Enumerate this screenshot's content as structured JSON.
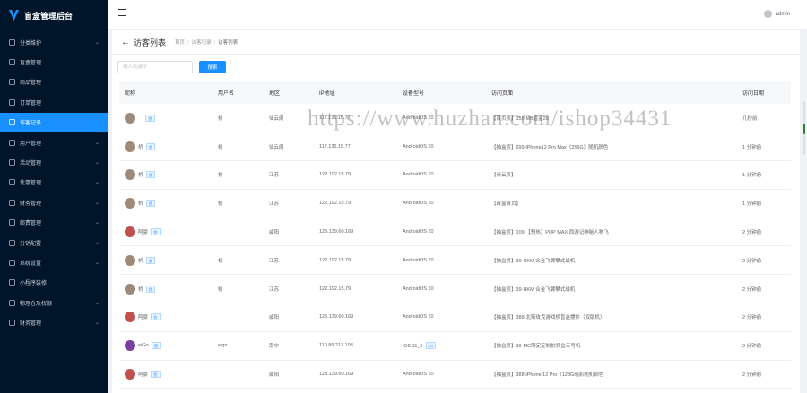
{
  "app": {
    "title": "盲盒管理后台"
  },
  "sidebar": {
    "items": [
      {
        "label": "分类维护",
        "icon": "grid-icon",
        "has_children": true,
        "active": false
      },
      {
        "label": "盲盒管理",
        "icon": "box-icon",
        "has_children": false,
        "active": false
      },
      {
        "label": "商品管理",
        "icon": "goods-icon",
        "has_children": false,
        "active": false
      },
      {
        "label": "订单管理",
        "icon": "order-icon",
        "has_children": false,
        "active": false
      },
      {
        "label": "访客记录",
        "icon": "visitor-icon",
        "has_children": false,
        "active": true
      },
      {
        "label": "用户管理",
        "icon": "user-icon",
        "has_children": true,
        "active": false
      },
      {
        "label": "活动管理",
        "icon": "activity-icon",
        "has_children": true,
        "active": false
      },
      {
        "label": "优惠管理",
        "icon": "coupon-icon",
        "has_children": true,
        "active": false
      },
      {
        "label": "财务管理",
        "icon": "finance-icon",
        "has_children": true,
        "active": false
      },
      {
        "label": "邮费管理",
        "icon": "shipping-icon",
        "has_children": true,
        "active": false
      },
      {
        "label": "分销配置",
        "icon": "share-icon",
        "has_children": true,
        "active": false
      },
      {
        "label": "系统设置",
        "icon": "settings-icon",
        "has_children": true,
        "active": false
      },
      {
        "label": "小程序装修",
        "icon": "miniapp-icon",
        "has_children": false,
        "active": false
      },
      {
        "label": "物理仓及权限",
        "icon": "warehouse-icon",
        "has_children": true,
        "active": false
      },
      {
        "label": "财务管理",
        "icon": "wallet-icon",
        "has_children": true,
        "active": false
      }
    ]
  },
  "header": {
    "username": "admin"
  },
  "page": {
    "title": "访客列表",
    "breadcrumb": [
      "首页",
      "访客记录",
      "访客列表"
    ]
  },
  "search": {
    "placeholder": "输入关键字",
    "button": "搜索"
  },
  "table": {
    "columns": [
      "昵称",
      "用户名",
      "地区",
      "IP地址",
      "设备型号",
      "访问页面",
      "访问日期"
    ],
    "rows": [
      {
        "nick": "ㅤ",
        "tag": "会",
        "user": "桥",
        "region": "仙云阁",
        "ip": "117.136.15.77",
        "device": "AndroidOS 10",
        "os_tag": "",
        "page": "【首页页】159-MB盲盒28",
        "date": "几秒前",
        "avatar": "#9e8a7a"
      },
      {
        "nick": "桥",
        "tag": "会",
        "user": "桥",
        "region": "仙云阁",
        "ip": "117.136.15.77",
        "device": "AndroidOS 10",
        "os_tag": "",
        "page": "【抽盒页】699-iPhone12 Pro Max（256G）随机颜色",
        "date": "1 分钟前",
        "avatar": "#9e8a7a"
      },
      {
        "nick": "桥",
        "tag": "会",
        "user": "桥",
        "region": "江苏",
        "ip": "122.192.15.79",
        "device": "AndroidOS 10",
        "os_tag": "",
        "page": "【分云页】",
        "date": "1 分钟前",
        "avatar": "#9e8a7a"
      },
      {
        "nick": "桥",
        "tag": "会",
        "user": "桥",
        "region": "江苏",
        "ip": "122.192.15.79",
        "device": "AndroidOS 10",
        "os_tag": "",
        "page": "【首盒首页】",
        "date": "1 分钟前",
        "avatar": "#9e8a7a"
      },
      {
        "nick": "阿豪",
        "tag": "会",
        "user": "",
        "region": "咸阳",
        "ip": "125.139.60.169",
        "device": "AndroidOS 10",
        "os_tag": "",
        "page": "【抽盒页】109 【预热】POP MAX 西游记神秘人物飞",
        "date": "2 分钟前",
        "avatar": "#c0504d"
      },
      {
        "nick": "桥",
        "tag": "会",
        "user": "桥",
        "region": "江苏",
        "ip": "122.192.15.79",
        "device": "AndroidOS 10",
        "os_tag": "",
        "page": "【抽盒页】39-HKM 合金飞翼攀式战机",
        "date": "2 分钟前",
        "avatar": "#9e8a7a"
      },
      {
        "nick": "桥",
        "tag": "会",
        "user": "桥",
        "region": "江苏",
        "ip": "122.192.15.79",
        "device": "AndroidOS 10",
        "os_tag": "",
        "page": "【抽盒页】39-HKM 合金飞翼攀式战机",
        "date": "2 分钟前",
        "avatar": "#9e8a7a"
      },
      {
        "nick": "阿豪",
        "tag": "会",
        "user": "",
        "region": "咸阳",
        "ip": "125.139.60.169",
        "device": "AndroidOS 10",
        "os_tag": "",
        "page": "【抽盒页】388-北斯玫克游戏机盲盒摆件（双版机）",
        "date": "2 分钟前",
        "avatar": "#c0504d"
      },
      {
        "nick": "eiGo",
        "tag": "普",
        "user": "eigo",
        "region": "南宁",
        "ip": "110.89.217.198",
        "device": "iOS 11_0",
        "os_tag": "ios",
        "page": "【抽盒页】39-MG限定定制拍奖盒三号机",
        "date": "2 分钟前",
        "avatar": "#7b3fa0"
      },
      {
        "nick": "阿豪",
        "tag": "会",
        "user": "",
        "region": "咸阳",
        "ip": "123.139.60.169",
        "device": "AndroidOS 10",
        "os_tag": "",
        "page": "【抽盒页】388-iPhone 12 Pro（128G暗影随机颜色",
        "date": "2 分钟前",
        "avatar": "#c0504d"
      }
    ]
  },
  "watermark": "https://www.huzhan.com/ishop34431",
  "colors": {
    "sidebar_bg": "#001529",
    "accent": "#1890ff"
  }
}
